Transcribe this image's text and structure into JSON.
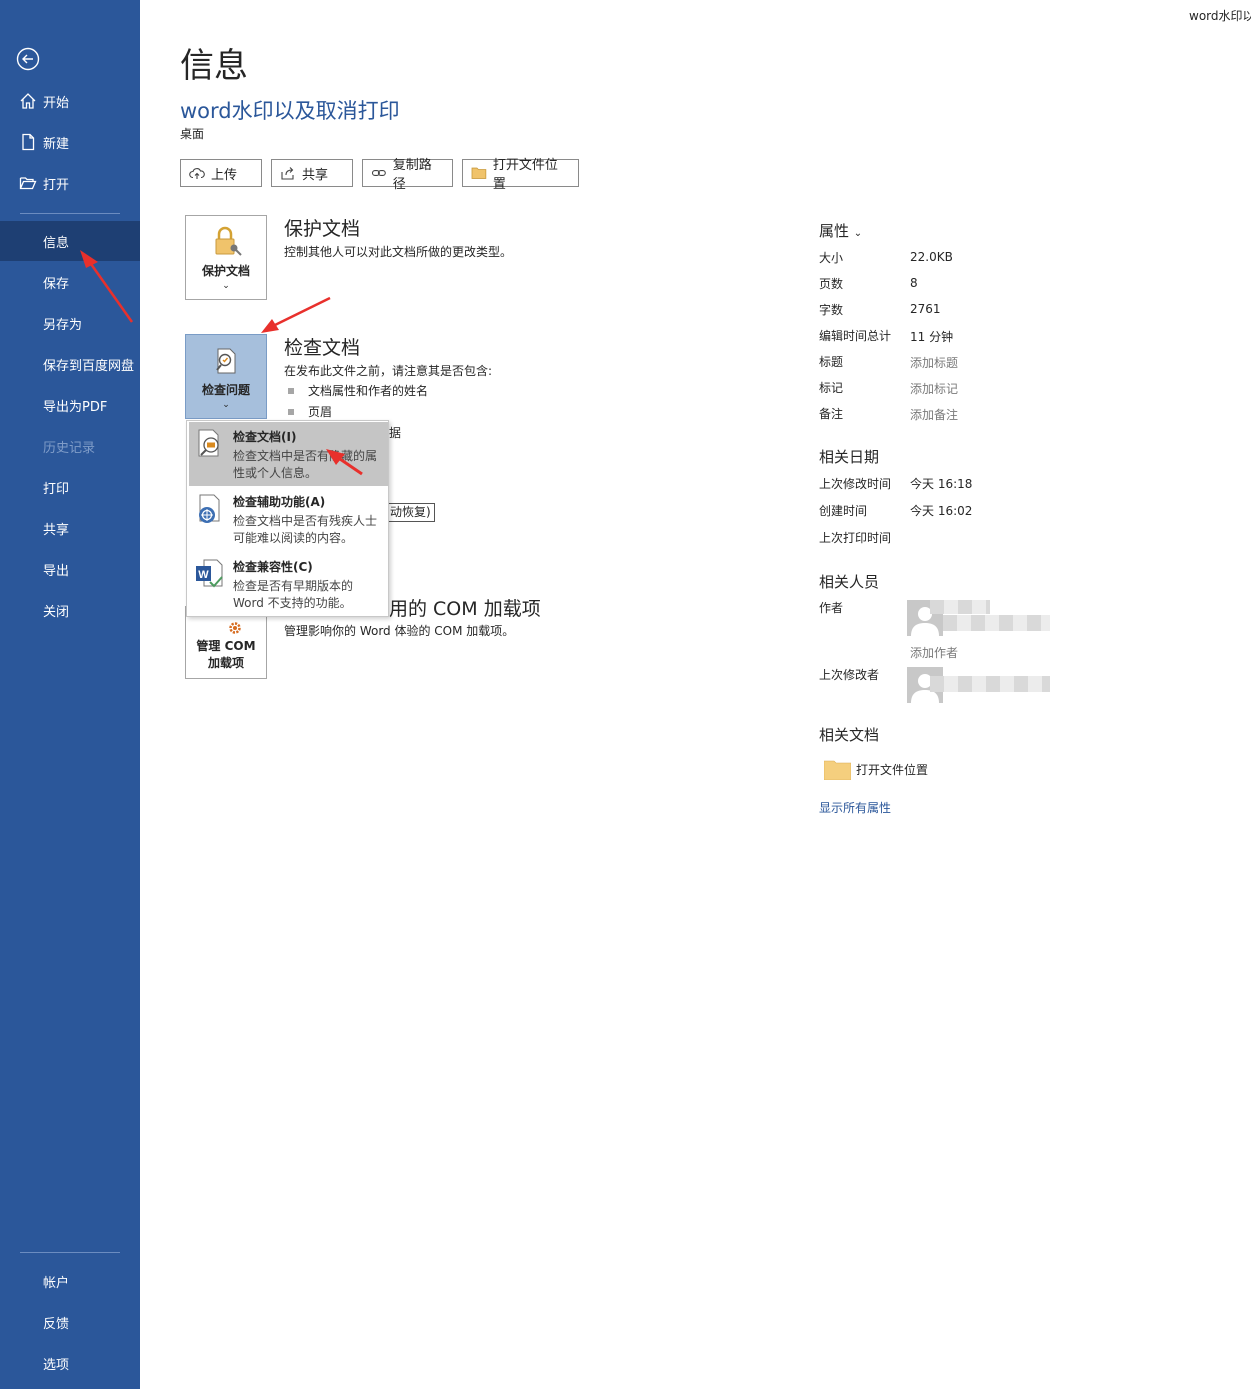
{
  "window": {
    "title_truncated": "word水印以"
  },
  "sidebar": {
    "items": [
      {
        "label": "开始"
      },
      {
        "label": "新建"
      },
      {
        "label": "打开"
      },
      {
        "label": "信息"
      },
      {
        "label": "保存"
      },
      {
        "label": "另存为"
      },
      {
        "label": "保存到百度网盘"
      },
      {
        "label": "导出为PDF"
      },
      {
        "label": "历史记录"
      },
      {
        "label": "打印"
      },
      {
        "label": "共享"
      },
      {
        "label": "导出"
      },
      {
        "label": "关闭"
      }
    ],
    "bottom": [
      {
        "label": "帐户"
      },
      {
        "label": "反馈"
      },
      {
        "label": "选项"
      }
    ]
  },
  "main": {
    "page_title": "信息",
    "doc_title": "word水印以及取消打印",
    "doc_location": "桌面",
    "toolbar": {
      "upload": "上传",
      "share": "共享",
      "copy_path": "复制路径",
      "open_location": "打开文件位置"
    },
    "protect": {
      "tile_label": "保护文档",
      "title": "保护文档",
      "desc": "控制其他人可以对此文档所做的更改类型。"
    },
    "inspect": {
      "tile_label": "检查问题",
      "title": "检查文档",
      "desc": "在发布此文件之前，请注意其是否包含:",
      "bullets": [
        "文档属性和作者的姓名",
        "页眉"
      ],
      "partial_bullet": "据",
      "partial_button": "动恢复)"
    },
    "com": {
      "tile_label_1": "管理 COM",
      "tile_label_2": "加载项",
      "title_visible": "禁用的 COM 加载项",
      "desc": "管理影响你的 Word 体验的 COM 加载项。"
    },
    "dropdown": {
      "items": [
        {
          "title": "检查文档(I)",
          "desc": "检查文档中是否有隐藏的属性或个人信息。"
        },
        {
          "title": "检查辅助功能(A)",
          "desc": "检查文档中是否有残疾人士可能难以阅读的内容。"
        },
        {
          "title": "检查兼容性(C)",
          "desc": "检查是否有早期版本的 Word 不支持的功能。"
        }
      ]
    }
  },
  "properties": {
    "heading": "属性",
    "rows": [
      {
        "label": "大小",
        "value": "22.0KB"
      },
      {
        "label": "页数",
        "value": "8"
      },
      {
        "label": "字数",
        "value": "2761"
      },
      {
        "label": "编辑时间总计",
        "value": "11 分钟"
      },
      {
        "label": "标题",
        "value": "添加标题"
      },
      {
        "label": "标记",
        "value": "添加标记"
      },
      {
        "label": "备注",
        "value": "添加备注"
      }
    ],
    "dates_heading": "相关日期",
    "dates": [
      {
        "label": "上次修改时间",
        "value": "今天 16:18"
      },
      {
        "label": "创建时间",
        "value": "今天 16:02"
      },
      {
        "label": "上次打印时间",
        "value": ""
      }
    ],
    "people_heading": "相关人员",
    "author_label": "作者",
    "add_author": "添加作者",
    "last_modified_by_label": "上次修改者",
    "related_docs_heading": "相关文档",
    "open_location": "打开文件位置",
    "show_all": "显示所有属性"
  },
  "colors": {
    "sidebar": "#2b579a",
    "sidebar_active": "#1e3f73",
    "accent": "#2b579a",
    "annotation_arrow": "#e8302c"
  }
}
